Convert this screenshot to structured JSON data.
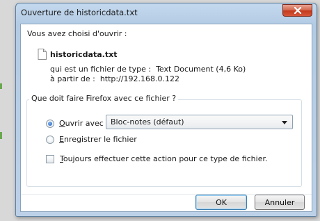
{
  "window": {
    "title": "Ouverture de historicdata.txt"
  },
  "dialog": {
    "prompt": "Vous avez choisi d'ouvrir :",
    "file_name": "historicdata.txt",
    "type_label": "qui est un fichier de type :",
    "type_value": "Text Document (4,6 Ko)",
    "from_label": "à partir de :",
    "from_value": "http://192.168.0.122",
    "question": "Que doit faire Firefox avec ce fichier ?",
    "open_with_label_mnemonic": "O",
    "open_with_label_rest": "uvrir avec",
    "open_with_app": "Bloc-notes (défaut)",
    "save_label_mnemonic": "E",
    "save_label_rest": "nregistrer le fichier",
    "always_label_mnemonic": "T",
    "always_label_rest": "oujours effectuer cette action pour ce type de fichier.",
    "selected_option": "open_with",
    "always_checked": false
  },
  "buttons": {
    "ok": "OK",
    "cancel": "Annuler"
  },
  "icons": {
    "close": "close-icon",
    "file": "text-file-icon"
  },
  "colors": {
    "title_bar": "#b9d1ea",
    "close_button": "#c94a2c",
    "radio_selected": "#1d5dbf"
  }
}
